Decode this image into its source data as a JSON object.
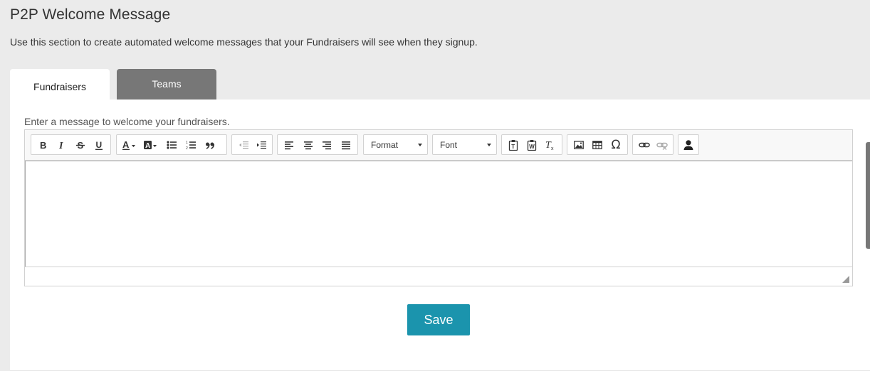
{
  "header": {
    "title": "P2P Welcome Message",
    "description": "Use this section to create automated welcome messages that your Fundraisers will see when they signup."
  },
  "tabs": [
    {
      "label": "Fundraisers",
      "active": true
    },
    {
      "label": "Teams",
      "active": false
    }
  ],
  "editor": {
    "label": "Enter a message to welcome your fundraisers.",
    "content": "",
    "toolbar": {
      "format_label": "Format",
      "font_label": "Font",
      "special_char": "Ω",
      "groups": [
        [
          "bold-icon",
          "italic-icon",
          "strikethrough-icon",
          "underline-icon"
        ],
        [
          "text-color-icon",
          "background-color-icon",
          "bulleted-list-icon",
          "numbered-list-icon",
          "blockquote-icon"
        ],
        [
          "decrease-indent-icon",
          "increase-indent-icon"
        ],
        [
          "align-left-icon",
          "align-center-icon",
          "align-right-icon",
          "justify-icon"
        ],
        [
          "paste-text-icon",
          "paste-word-icon",
          "remove-format-icon"
        ],
        [
          "image-icon",
          "table-icon",
          "special-character-icon"
        ],
        [
          "link-icon",
          "unlink-icon"
        ],
        [
          "user-icon"
        ]
      ]
    }
  },
  "actions": {
    "save_label": "Save"
  },
  "colors": {
    "accent": "#1b94ad",
    "inactive_tab": "#777777",
    "page_bg": "#ebebeb"
  }
}
